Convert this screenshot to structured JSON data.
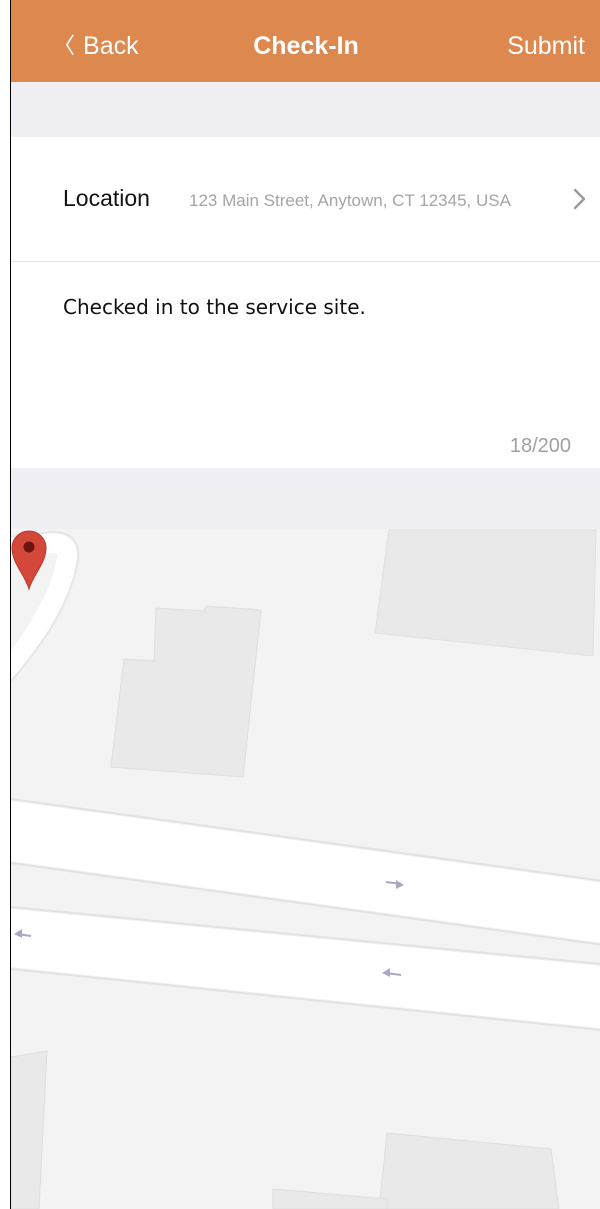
{
  "nav": {
    "back_label": "Back",
    "back_chevron": "〈",
    "title": "Check-In",
    "submit_label": "Submit",
    "bar_color": "#dc884f"
  },
  "form": {
    "location_label": "Location",
    "location_value": "123 Main Street, Anytown, CT 12345, USA",
    "note_text": "Checked in to the service site.",
    "char_counter": "18/200"
  },
  "map": {
    "pin_icon": "map-pin-icon",
    "pin_color": "#d3483a",
    "direction_icon": "arrow-icon"
  }
}
